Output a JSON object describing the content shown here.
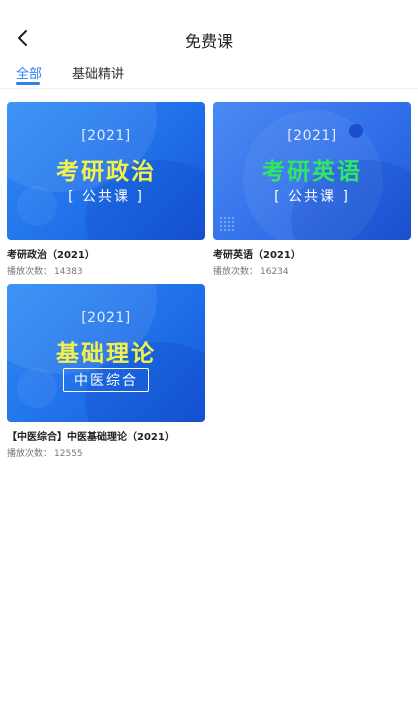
{
  "header": {
    "title": "免费课",
    "back_icon": "chevron-left-icon"
  },
  "tabs": [
    {
      "label": "全部",
      "active": true
    },
    {
      "label": "基础精讲",
      "active": false
    }
  ],
  "accent_color": "#2f7df6",
  "courses": [
    {
      "thumb": {
        "year": "[2021]",
        "title": "考研政治",
        "subtitle": "[  公共课  ]",
        "title_color": "#f4f14a"
      },
      "name": "考研政治（2021）",
      "plays_label": "播放次数：",
      "plays": "14383"
    },
    {
      "thumb": {
        "year": "[2021]",
        "title": "考研英语",
        "subtitle": "[  公共课  ]",
        "title_color": "#2ee860"
      },
      "name": "考研英语（2021）",
      "plays_label": "播放次数：",
      "plays": "16234"
    },
    {
      "thumb": {
        "year": "[2021]",
        "title": "基础理论",
        "subtitle": "中医综合",
        "title_color": "#f4f14a"
      },
      "name": "【中医综合】中医基础理论（2021）",
      "plays_label": "播放次数：",
      "plays": "12555"
    }
  ]
}
